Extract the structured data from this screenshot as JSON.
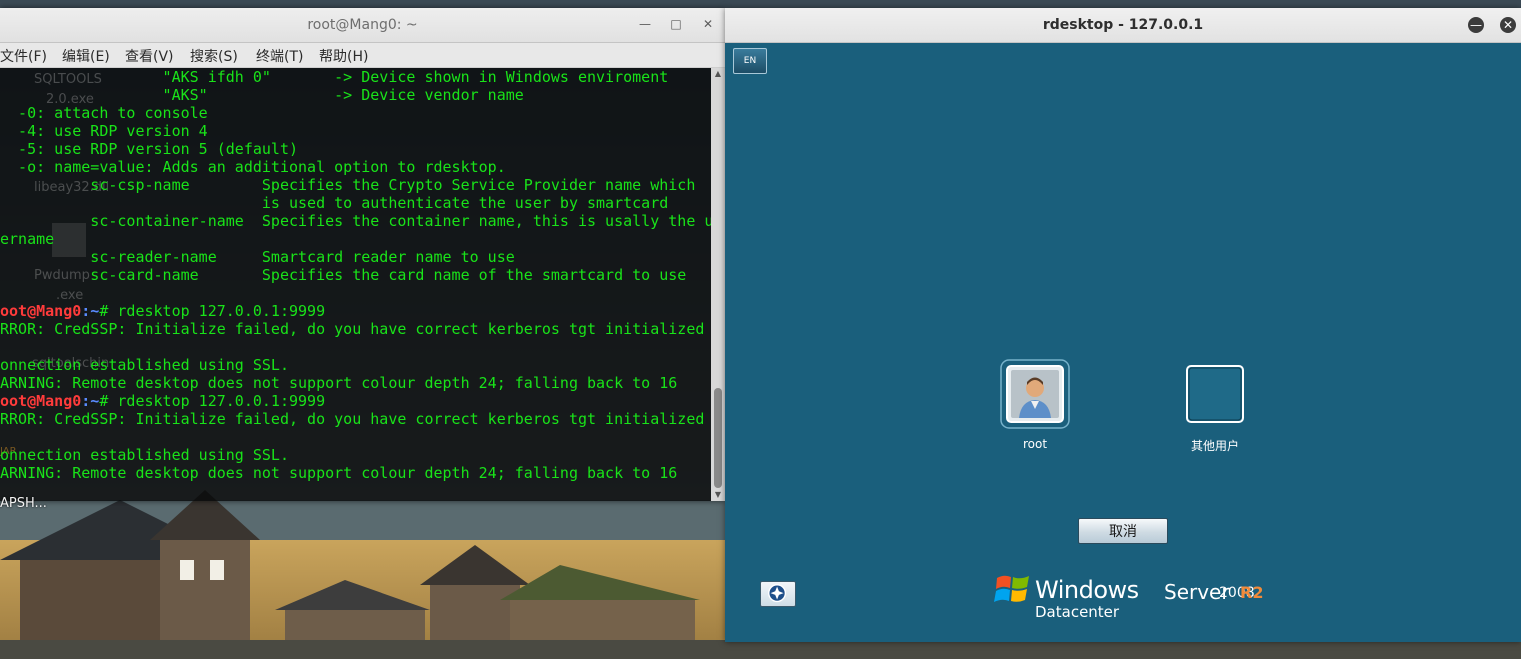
{
  "terminal": {
    "title": "root@Mang0: ~",
    "controls": {
      "minimize": "—",
      "maximize": "□",
      "close": "✕"
    },
    "menu": [
      "文件(F)",
      "编辑(E)",
      "查看(V)",
      "搜索(S)",
      "终端(T)",
      "帮助(H)"
    ],
    "lines": [
      {
        "text": "                  \"AKS ifdh 0\"       -> Device shown in Windows enviroment"
      },
      {
        "text": "                  \"AKS\"              -> Device vendor name"
      },
      {
        "text": "  -0: attach to console"
      },
      {
        "text": "  -4: use RDP version 4"
      },
      {
        "text": "  -5: use RDP version 5 (default)"
      },
      {
        "text": "  -o: name=value: Adds an additional option to rdesktop."
      },
      {
        "text": "          sc-csp-name        Specifies the Crypto Service Provider name which"
      },
      {
        "text": "                             is used to authenticate the user by smartcard"
      },
      {
        "text": "          sc-container-name  Specifies the container name, this is usally the u"
      },
      {
        "text": "ername"
      },
      {
        "text": "          sc-reader-name     Smartcard reader name to use"
      },
      {
        "text": "          sc-card-name       Specifies the card name of the smartcard to use"
      },
      {
        "text": ""
      },
      {
        "user": "oot@Mang0",
        "path": ":~",
        "text": "# rdesktop 127.0.0.1:9999"
      },
      {
        "text": "RROR: CredSSP: Initialize failed, do you have correct kerberos tgt initialized"
      },
      {
        "text": ""
      },
      {
        "text": "onnection established using SSL."
      },
      {
        "text": "ARNING: Remote desktop does not support colour depth 24; falling back to 16"
      },
      {
        "user": "oot@Mang0",
        "path": ":~",
        "text": "# rdesktop 127.0.0.1:9999"
      },
      {
        "text": "RROR: CredSSP: Initialize failed, do you have correct kerberos tgt initialized"
      },
      {
        "text": ""
      },
      {
        "text": "onnection established using SSL."
      },
      {
        "text": "ARNING: Remote desktop does not support colour depth 24; falling back to 16"
      }
    ]
  },
  "desktop": {
    "icons": [
      "SQLTOOLS",
      "2.0.exe",
      "libeay32.dll",
      "Pwdump",
      ".exe",
      "sqltoolschin",
      "JAR"
    ],
    "below_label": "APSH..."
  },
  "rdesktop": {
    "title": "rdesktop - 127.0.0.1",
    "controls": {
      "minimize": "—",
      "close": "✕"
    },
    "lang_indicator": "EN",
    "users": [
      {
        "label": "root"
      },
      {
        "label": "其他用户"
      }
    ],
    "cancel_label": "取消",
    "brand": {
      "windows": "Windows",
      "server": "Server",
      "year": "2008",
      "release": "R2",
      "edition": "Datacenter"
    }
  },
  "colors": {
    "terminal_text": "#19e319",
    "prompt_user": "#ff3b3b",
    "prompt_path": "#5a8cff",
    "rdp_background": "#1a5f7c",
    "brand_accent": "#f08a3a"
  }
}
